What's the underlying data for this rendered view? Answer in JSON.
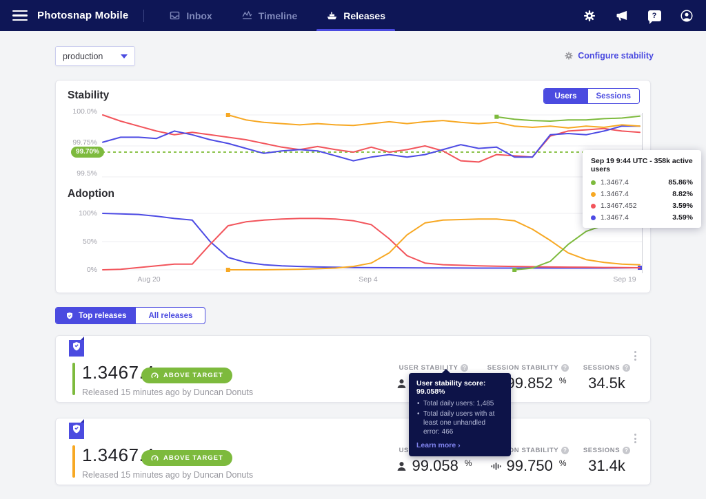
{
  "nav": {
    "brand": "Photosnap Mobile",
    "items": [
      {
        "label": "Inbox"
      },
      {
        "label": "Timeline"
      },
      {
        "label": "Releases"
      }
    ],
    "right_icons": [
      "settings",
      "announcements",
      "help",
      "account"
    ]
  },
  "misc": {
    "q": "?"
  },
  "toolbar": {
    "environment": "production",
    "configure_label": "Configure stability"
  },
  "stability": {
    "title": "Stability",
    "toggle": {
      "users": "Users",
      "sessions": "Sessions"
    },
    "target_label": "99.70%",
    "yticks": [
      "100.0%",
      "99.75%",
      "99.5%"
    ]
  },
  "adoption": {
    "title": "Adoption",
    "yticks": [
      "100%",
      "50%",
      "0%"
    ],
    "xticks": [
      "Aug 20",
      "Sep 4",
      "Sep 19"
    ]
  },
  "chart_tooltip": {
    "title": "Sep 19 9:44 UTC - 358k active users",
    "rows": [
      {
        "version": "1.3467.4",
        "value": "85.86%",
        "color": "#7dba3d"
      },
      {
        "version": "1.3467.4",
        "value": "8.82%",
        "color": "#f7a823"
      },
      {
        "version": "1.3467.452",
        "value": "3.59%",
        "color": "#f2545b"
      },
      {
        "version": "1.3467.4",
        "value": "3.59%",
        "color": "#4d4be4"
      }
    ]
  },
  "tabs": {
    "top_label": "Top releases",
    "all_label": "All releases"
  },
  "cards": [
    {
      "version": "1.3467.4",
      "badge": "ABOVE TARGET",
      "released": "Released 15 minutes ago by Duncan Donuts",
      "accent": "#7dba3d",
      "stats": {
        "user_label": "USER STABILITY",
        "user": "99.058",
        "user_unit": "%",
        "session_label": "SESSION STABILITY",
        "session": "99.852",
        "session_unit": "%",
        "sessions_label": "SESSIONS",
        "sessions": "34.5k"
      }
    },
    {
      "version": "1.3467.4",
      "badge": "ABOVE TARGET",
      "released": "Released 15 minutes ago by Duncan Donuts",
      "accent": "#f7a823",
      "stats": {
        "user_label": "USER STABILITY",
        "user": "99.058",
        "user_unit": "%",
        "session_label": "SESSION STABILITY",
        "session": "99.750",
        "session_unit": "%",
        "sessions_label": "SESSIONS",
        "sessions": "31.4k"
      }
    }
  ],
  "stat_tooltip": {
    "title": "User stability score: 99.058%",
    "bullets": [
      "Total daily users: 1,485",
      "Total daily users with at least one unhandled error: 466"
    ],
    "link": "Learn more ›"
  },
  "colors": {
    "navy": "#0e1656",
    "accent": "#4b4be0",
    "green": "#7dba3d",
    "orange": "#f7a823",
    "red": "#f2545b",
    "blue": "#4d4be4",
    "target_line": "#8bc34a"
  },
  "chart_data": [
    {
      "type": "line",
      "title": "Stability",
      "ylabel": "stability",
      "ylim": [
        99.5,
        100.0
      ],
      "ytick_values": [
        100.0,
        99.75,
        99.5
      ],
      "target": 99.7,
      "x_count": 31,
      "xticks": [
        "Aug 20",
        "Sep 4",
        "Sep 19"
      ],
      "legend_position": "tooltip",
      "series": [
        {
          "name": "1.3467.452",
          "color": "#f2545b",
          "start": 0,
          "values": [
            100,
            99.95,
            99.91,
            99.87,
            99.84,
            99.86,
            99.84,
            99.82,
            99.8,
            99.77,
            99.74,
            99.72,
            99.745,
            99.72,
            99.7,
            99.74,
            99.7,
            99.72,
            99.75,
            99.71,
            99.63,
            99.62,
            99.68,
            99.67,
            99.66,
            99.83,
            99.87,
            99.88,
            99.89,
            99.87,
            99.86
          ]
        },
        {
          "name": "1.3467.4",
          "color": "#4d4be4",
          "start": 0,
          "values": [
            99.78,
            99.82,
            99.82,
            99.81,
            99.87,
            99.84,
            99.8,
            99.77,
            99.73,
            99.69,
            99.71,
            99.72,
            99.71,
            99.67,
            99.63,
            99.66,
            99.68,
            99.66,
            99.68,
            99.72,
            99.76,
            99.73,
            99.74,
            99.66,
            99.66,
            99.84,
            99.85,
            99.84,
            99.87,
            99.91,
            99.91
          ]
        },
        {
          "name": "1.3467.4",
          "color": "#f7a823",
          "start": 7,
          "marker": "start",
          "values": [
            100,
            99.96,
            99.94,
            99.93,
            99.92,
            99.93,
            99.92,
            99.915,
            99.93,
            99.945,
            99.93,
            99.945,
            99.955,
            99.94,
            99.93,
            99.94,
            99.91,
            99.9,
            99.91,
            99.895,
            99.91,
            99.9,
            99.92,
            99.91
          ]
        },
        {
          "name": "1.3467.4",
          "color": "#7dba3d",
          "start": 22,
          "marker": "start",
          "values": [
            99.985,
            99.965,
            99.955,
            99.95,
            99.96,
            99.96,
            99.97,
            99.975,
            99.99
          ]
        }
      ]
    },
    {
      "type": "line",
      "title": "Adoption",
      "ylabel": "adoption",
      "ylim": [
        0,
        100
      ],
      "ytick_values": [
        100,
        50,
        0
      ],
      "x_count": 31,
      "xticks": [
        "Aug 20",
        "Sep 4",
        "Sep 19"
      ],
      "series": [
        {
          "name": "1.3467.4",
          "color": "#4d4be4",
          "start": 0,
          "marker": "end",
          "values": [
            100,
            99,
            98,
            95,
            91,
            88,
            50,
            22,
            13,
            9,
            7,
            6,
            5,
            4.5,
            4,
            3.8,
            3.6,
            3.5,
            3.4,
            3.3,
            3.2,
            3.1,
            3,
            3,
            3,
            3,
            3,
            3,
            3,
            3.3,
            3.6
          ]
        },
        {
          "name": "1.3467.452",
          "color": "#f2545b",
          "start": 0,
          "values": [
            0,
            1,
            4,
            7,
            10,
            10,
            45,
            78,
            85,
            88,
            90,
            91,
            91,
            90,
            87,
            80,
            55,
            25,
            12,
            9,
            8,
            7,
            6.5,
            6,
            5.5,
            5,
            4.8,
            4.5,
            4.2,
            4,
            3.6
          ]
        },
        {
          "name": "1.3467.4",
          "color": "#f7a823",
          "start": 7,
          "marker": "start",
          "values": [
            0,
            0,
            0,
            0.5,
            1,
            2,
            3,
            6,
            12,
            30,
            62,
            83,
            88,
            89,
            90,
            90,
            87,
            72,
            52,
            30,
            18,
            13,
            10,
            8.8
          ]
        },
        {
          "name": "1.3467.4",
          "color": "#7dba3d",
          "start": 23,
          "marker": "start",
          "values": [
            0,
            3,
            15,
            45,
            68,
            79,
            84,
            86
          ]
        }
      ]
    }
  ]
}
